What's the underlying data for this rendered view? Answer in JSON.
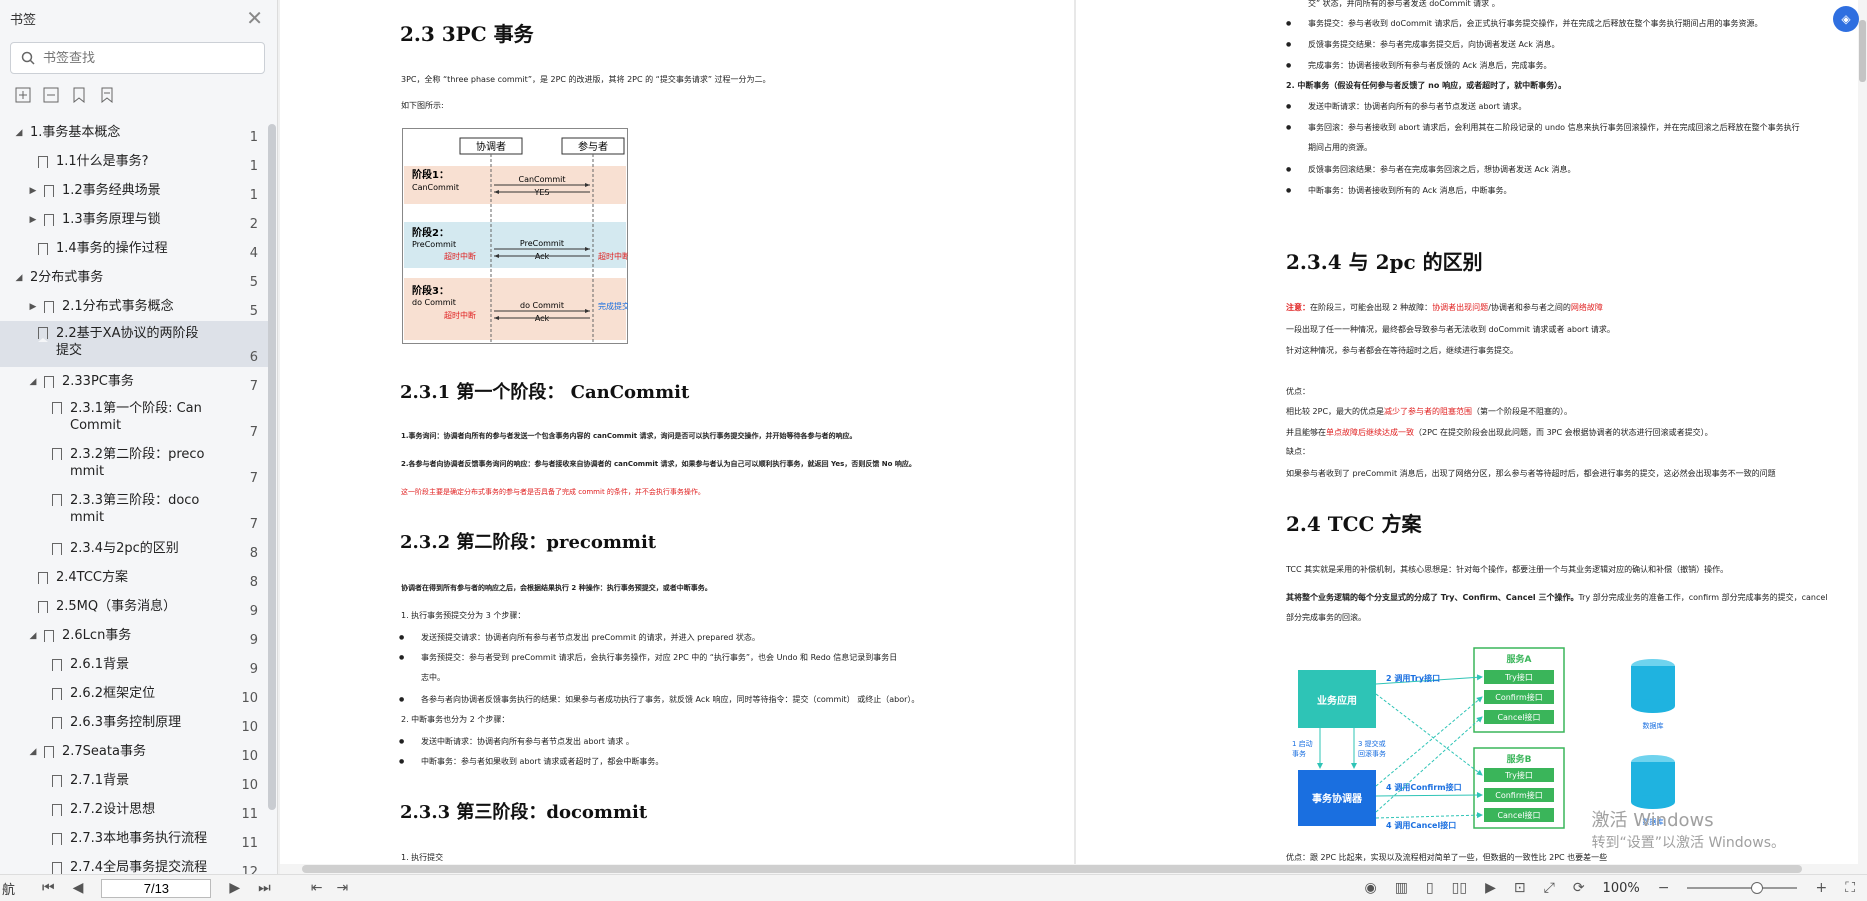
{
  "sidebar": {
    "title": "书签",
    "search_placeholder": "书签查找",
    "items": [
      {
        "label": "1.事务基本概念",
        "page": "1"
      },
      {
        "label": "1.1什么是事务?",
        "page": "1"
      },
      {
        "label": "1.2事务经典场景",
        "page": "1"
      },
      {
        "label": "1.3事务原理与锁",
        "page": "2"
      },
      {
        "label": "1.4事务的操作过程",
        "page": "4"
      },
      {
        "label": "2分布式事务",
        "page": "5"
      },
      {
        "label": "2.1分布式事务概念",
        "page": "5"
      },
      {
        "label": "2.2基于XA协议的两阶段提交",
        "page": "6"
      },
      {
        "label": "2.33PC事务",
        "page": "7"
      },
      {
        "label": "2.3.1第一个阶段: Can Commit",
        "page": "7"
      },
      {
        "label": "2.3.2第二阶段：precommit",
        "page": "7"
      },
      {
        "label": "2.3.3第三阶段：docommit",
        "page": "7"
      },
      {
        "label": "2.3.4与2pc的区别",
        "page": "8"
      },
      {
        "label": "2.4TCC方案",
        "page": "8"
      },
      {
        "label": "2.5MQ（事务消息）",
        "page": "9"
      },
      {
        "label": "2.6Lcn事务",
        "page": "9"
      },
      {
        "label": "2.6.1背景",
        "page": "9"
      },
      {
        "label": "2.6.2框架定位",
        "page": "10"
      },
      {
        "label": "2.6.3事务控制原理",
        "page": "10"
      },
      {
        "label": "2.7Seata事务",
        "page": "10"
      },
      {
        "label": "2.7.1背景",
        "page": "10"
      },
      {
        "label": "2.7.2设计思想",
        "page": "11"
      },
      {
        "label": "2.7.3本地事务执行流程",
        "page": "11"
      },
      {
        "label": "2.7.4全局事务提交流程",
        "page": "12"
      }
    ]
  },
  "left_page": {
    "h_3pc": "2.3  3PC 事务",
    "intro": "3PC，全称 “three phase commit”，是 2PC 的改进版，其将 2PC 的 “提交事务请求” 过程一分为二。",
    "fig_caption": "如下图所示:",
    "diagram": {
      "coord": "协调者",
      "part": "参与者",
      "s1": "阶段1：",
      "s1b": "CanCommit",
      "s1m1": "CanCommit",
      "s1m2": "YES",
      "s2": "阶段2：",
      "s2b": "PreCommit",
      "s2m1": "PreCommit",
      "s2m2": "Ack",
      "timeout": "超时中断",
      "s3": "阶段3：",
      "s3b": "do Commit",
      "s3m1": "do Commit",
      "s3m2": "Ack",
      "done": "完成提交"
    },
    "h_231": "2.3.1 第一个阶段：  CanCommit",
    "p231a": "1.事务询问：协调者向所有的参与者发送一个包含事务内容的 canCommit 请求，询问是否可以执行事务提交操作，并开始等待各参与者的响应。",
    "p231b": "2.各参与者向协调者反馈事务询问的响应：参与者接收来自协调者的 canCommit 请求，如果参与者认为自己可以顺利执行事务，就返回 Yes，否则反馈 No 响应。",
    "p231c": "这一阶段主要是确定分布式事务的参与者是否具备了完成 commit 的条件，并不会执行事务操作。",
    "h_232": "2.3.2 第二阶段：precommit",
    "p232": "协调者在得到所有参与者的响应之后，会根据结果执行 2 种操作：执行事务预提交，或者中断事务。",
    "p232s1": "1. 执行事务预提交分为 3 个步骤：",
    "b1": "发送预提交请求：协调者向所有参与者节点发出 preCommit 的请求，并进入 prepared 状态。",
    "b2": "事务预提交：参与者受到 preCommit 请求后，会执行事务操作，对应 2PC 中的 “执行事务”，也会 Undo 和 Redo 信息记录到事务日",
    "b2b": "志中。",
    "b3": "各参与者向协调者反馈事务执行的结果：如果参与者成功执行了事务，就反馈 Ack 响应，同时等待指令：提交（commit） 或终止（abor）。",
    "p232s2": "2. 中断事务也分为 2 个步骤：",
    "b4": "发送中断请求：协调者向所有参与者节点发出 abort 请求 。",
    "b5": "中断事务：参与者如果收到 abort 请求或者超时了，都会中断事务。",
    "h_233": "2.3.3 第三阶段：docommit",
    "p233": "1. 执行提交"
  },
  "right_page": {
    "r0": "交” 状态，并向所有的参与者发送 doCommit 请求 。",
    "rb1": "事务提交：参与者收到 doCommit 请求后，会正式执行事务提交操作，并在完成之后释放在整个事务执行期间占用的事务资源。",
    "rb2": "反馈事务提交结果：参与者完成事务提交后，向协调者发送 Ack 消息。",
    "rb3": "完成事务：协调者接收到所有参与者反馈的 Ack 消息后，完成事务。",
    "r2": "2. 中断事务（假设有任何参与者反馈了 no 响应，或者超时了，就中断事务）。",
    "rb4": "发送中断请求：协调者向所有的参与者节点发送 abort 请求。",
    "rb5": "事务回滚：参与者接收到 abort 请求后，会利用其在二阶段记录的 undo 信息来执行事务回滚操作，并在完成回滚之后释放在整个事务执行",
    "rb5b": "期间占用的资源。",
    "rb6": "反馈事务回滚结果：参与者在完成事务回滚之后，想协调者发送 Ack 消息。",
    "rb7": "中断事务：协调者接收到所有的 Ack 消息后，中断事务。",
    "h_234": "2.3.4 与 2pc 的区别",
    "n1a": "注意：",
    "n1b": "在阶段三，可能会出现 2 种故障：",
    "n1c": "协调者出现问题",
    "n1d": "/协调者和参与者之间的",
    "n1e": "网络故障",
    "n2": "一段出现了任一一种情况，最终都会导致参与者无法收到 doCommit 请求或者 abort 请求。",
    "n3": "针对这种情况，参与者都会在等待超时之后，继续进行事务提交。",
    "adv": "优点：",
    "adv1a": "相比较 2PC，最大的优点是",
    "adv1b": "减少了参与者的阻塞范围",
    "adv1c": "（第一个阶段是不阻塞的）。",
    "adv2a": "并且能够在",
    "adv2b": "单点故障后继续达成一致",
    "adv2c": "（2PC 在提交阶段会出现此问题，而 3PC 会根据协调者的状态进行回滚或者提交）。",
    "dis": "缺点：",
    "dis1": "如果参与者收到了 preCommit 消息后，出现了网络分区，那么参与者等待超时后，都会进行事务的提交，这必然会出现事务不一致的问题",
    "h_24": "2.4  TCC 方案",
    "tcc1": "TCC 其实就是采用的补偿机制，其核心思想是：针对每个操作，都要注册一个与其业务逻辑对应的确认和补偿（撤销）操作。",
    "tcc2a": "其将整个业务逻辑的每个分支显式的分成了 Try、Confirm、Cancel 三个操作。",
    "tcc2b": "Try 部分完成业务的准备工作，confirm 部分完成事务的提交，cancel",
    "tcc3": "部分完成事务的回滚。",
    "tccfig": {
      "app": "业务应用",
      "coord": "事务协调器",
      "svcA": "服务A",
      "svcB": "服务B",
      "try": "Try接口",
      "confirm": "Confirm接口",
      "cancel": "Cancel接口",
      "e1": "1 启动",
      "e1b": "事务",
      "e2": "2 调用Try接口",
      "e3": "3 提交或",
      "e3b": "回滚事务",
      "e4": "4 调用Confirm接口",
      "e5": "4 调用Cancel接口",
      "db": "数据库"
    },
    "last": "优点：跟 2PC 比起来，实现以及流程相对简单了一些，但数据的一致性比 2PC 也要差一些"
  },
  "watermark": {
    "line1": "激活 Windows",
    "line2": "转到“设置”以激活 Windows。"
  },
  "status": {
    "nav_label": "航",
    "page_value": "7/13",
    "zoom": "100%"
  },
  "colors": {
    "accent": "#2f6fe0",
    "red": "#e02020",
    "teal": "#2ec4b6",
    "blue": "#1a6fe0",
    "green": "#3ab55a",
    "cyan": "#1fb3e0"
  }
}
